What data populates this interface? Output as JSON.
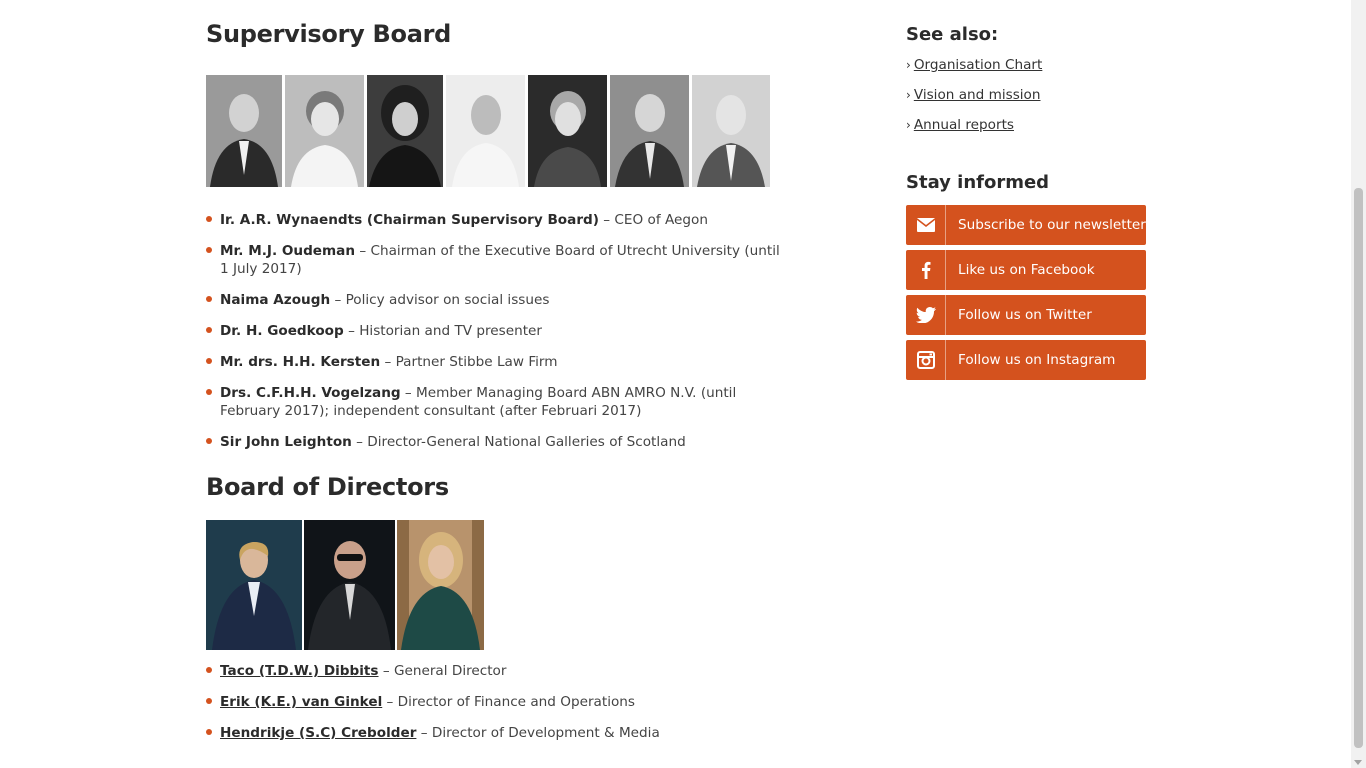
{
  "supervisory": {
    "title": "Supervisory Board",
    "members": [
      {
        "name": "Ir. A.R. Wynaendts (Chairman Supervisory Board)",
        "role": " – CEO of Aegon"
      },
      {
        "name": "Mr. M.J. Oudeman",
        "role": " – Chairman of the Executive Board of Utrecht University (until 1 July 2017)"
      },
      {
        "name": "Naima Azough",
        "role": " – Policy advisor on social issues"
      },
      {
        "name": "Dr. H. Goedkoop",
        "role": " – Historian and TV presenter"
      },
      {
        "name": "Mr. drs. H.H. Kersten",
        "role": " – Partner Stibbe Law Firm"
      },
      {
        "name": "Drs. C.F.H.H. Vogelzang",
        "role": " – Member Managing Board ABN AMRO N.V. (until February 2017); independent consultant (after Februari 2017)"
      },
      {
        "name": "Sir John Leighton",
        "role": " – Director-General National Galleries of Scotland"
      }
    ]
  },
  "directors": {
    "title": "Board of Directors",
    "members": [
      {
        "name": "Taco (T.D.W.) Dibbits",
        "role": " – General Director"
      },
      {
        "name": "Erik (K.E.) van Ginkel",
        "role": " – Director of Finance and Operations"
      },
      {
        "name": "Hendrikje (S.C) Crebolder",
        "role": " – Director of Development & Media"
      }
    ]
  },
  "sidebar": {
    "see_also_title": "See also:",
    "links": [
      "Organisation Chart",
      "Vision and mission",
      "Annual reports"
    ],
    "stay_title": "Stay informed",
    "buttons": [
      {
        "label": "Subscribe to our newsletter",
        "icon": "mail-icon"
      },
      {
        "label": "Like us on Facebook",
        "icon": "facebook-icon"
      },
      {
        "label": "Follow us on Twitter",
        "icon": "twitter-icon"
      },
      {
        "label": "Follow us on Instagram",
        "icon": "instagram-icon"
      }
    ]
  },
  "colors": {
    "accent": "#d4521e"
  }
}
